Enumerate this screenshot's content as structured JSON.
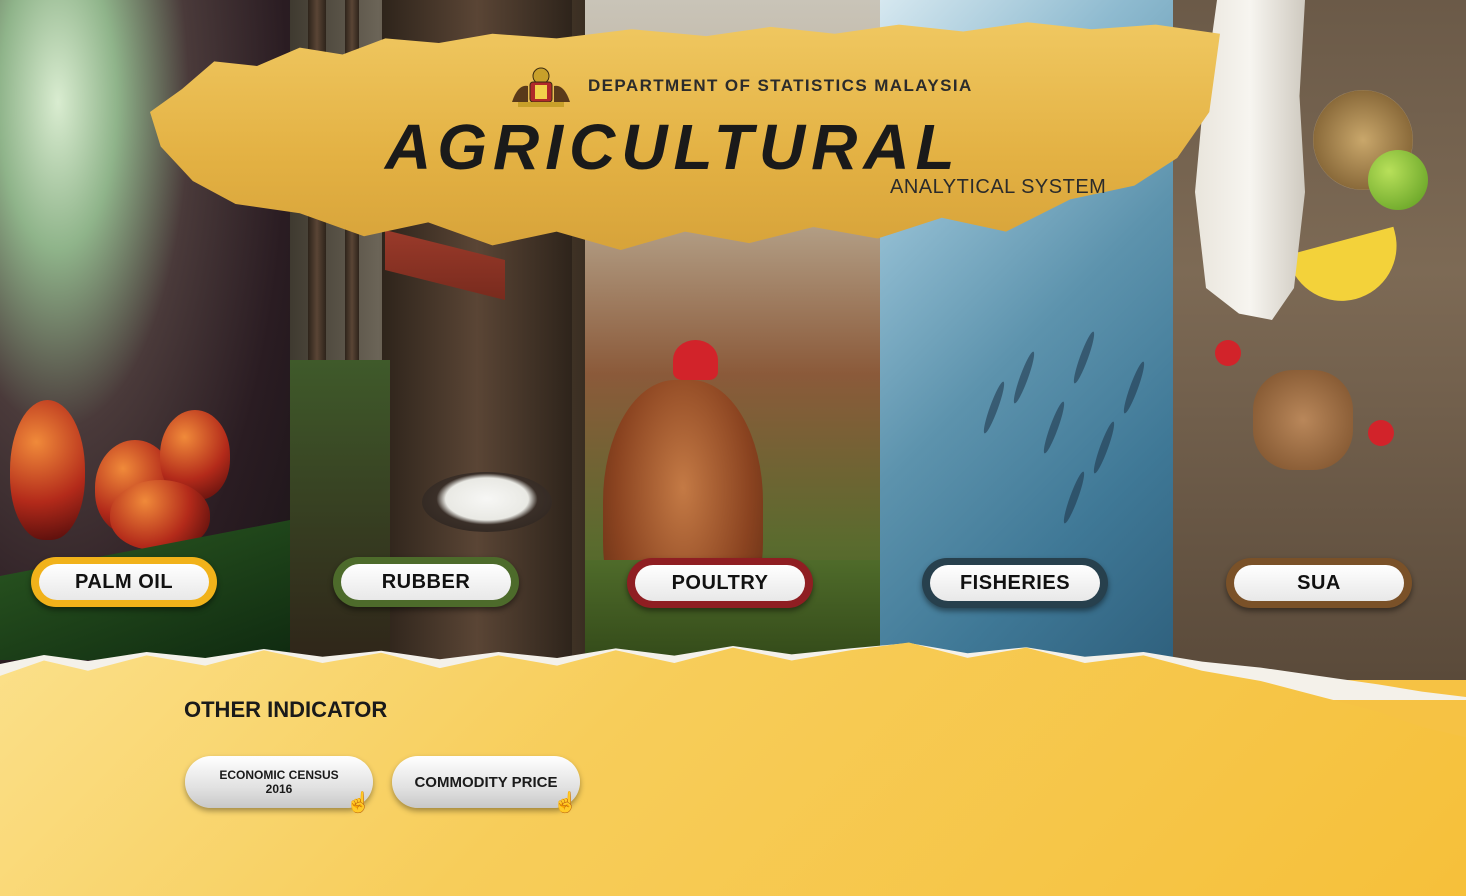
{
  "header": {
    "department": "DEPARTMENT OF STATISTICS MALAYSIA",
    "title": "AGRICULTURAL",
    "subtitle": "ANALYTICAL SYSTEM"
  },
  "categories": [
    {
      "label": "PALM OIL",
      "color": "#f1b21a"
    },
    {
      "label": "RUBBER",
      "color": "#4d6b2b"
    },
    {
      "label": "POULTRY",
      "color": "#8f1e22"
    },
    {
      "label": "FISHERIES",
      "color": "#27404d"
    },
    {
      "label": "SUA",
      "color": "#7a5128"
    }
  ],
  "other": {
    "title": "OTHER INDICATOR",
    "buttons": [
      {
        "line1": "ECONOMIC CENSUS",
        "line2": "2016",
        "icon": "hand-pointer-icon"
      },
      {
        "label": "COMMODITY PRICE",
        "icon": "hand-pointer-icon"
      }
    ]
  }
}
